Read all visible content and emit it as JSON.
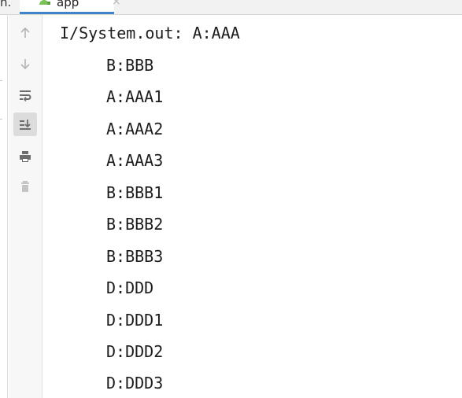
{
  "tabs": {
    "prev_tab_label": "n.",
    "active_tab_label": "app",
    "close_glyph": "×",
    "accent_color": "#4083c9",
    "android_icon_color": "#78c257"
  },
  "toolbar": {
    "buttons": [
      {
        "name": "scroll-up",
        "icon": "arrow-up-icon",
        "active": false
      },
      {
        "name": "scroll-down",
        "icon": "arrow-down-icon",
        "active": false
      },
      {
        "name": "soft-wrap",
        "icon": "soft-wrap-icon",
        "active": false
      },
      {
        "name": "scroll-to-end",
        "icon": "scroll-to-end-icon",
        "active": true
      },
      {
        "name": "print",
        "icon": "printer-icon",
        "active": false
      },
      {
        "name": "clear-all",
        "icon": "trash-icon",
        "active": false
      }
    ]
  },
  "console": {
    "lines": [
      "I/System.out: A:AAA",
      "B:BBB",
      "A:AAA1",
      "A:AAA2",
      "A:AAA3",
      "B:BBB1",
      "B:BBB2",
      "B:BBB3",
      "D:DDD",
      "D:DDD1",
      "D:DDD2",
      "D:DDD3"
    ]
  }
}
